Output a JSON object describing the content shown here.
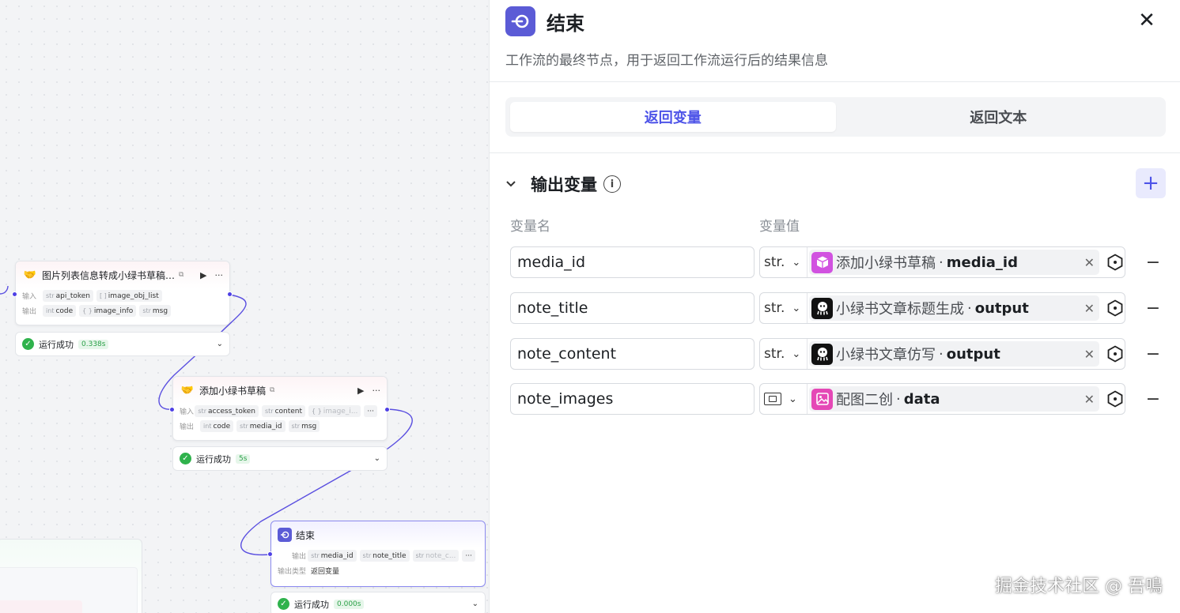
{
  "canvas": {
    "node1": {
      "title": "图片列表信息转成小绿书草稿…",
      "input_label": "输入",
      "output_label": "输出",
      "inputs": [
        {
          "type": "str",
          "name": "api_token"
        },
        {
          "type": "[ ]",
          "name": "image_obj_list"
        }
      ],
      "outputs": [
        {
          "type": "int",
          "name": "code"
        },
        {
          "type": "{ }",
          "name": "image_info"
        },
        {
          "type": "str",
          "name": "msg"
        }
      ],
      "status": "运行成功",
      "time": "0.338s"
    },
    "node2": {
      "title": "添加小绿书草稿",
      "input_label": "输入",
      "output_label": "输出",
      "inputs": [
        {
          "type": "str",
          "name": "access_token"
        },
        {
          "type": "str",
          "name": "content"
        },
        {
          "type": "{ }",
          "name": "image_i..."
        }
      ],
      "outputs": [
        {
          "type": "int",
          "name": "code"
        },
        {
          "type": "str",
          "name": "media_id"
        },
        {
          "type": "str",
          "name": "msg"
        }
      ],
      "status": "运行成功",
      "time": "5s"
    },
    "node3": {
      "title": "结束",
      "output_label": "输出",
      "outputs": [
        {
          "type": "str",
          "name": "media_id"
        },
        {
          "type": "str",
          "name": "note_title"
        },
        {
          "type": "str",
          "name": "note_c..."
        }
      ],
      "output_type_label": "输出类型",
      "output_type_value": "返回变量",
      "status": "运行成功",
      "time": "0.000s"
    }
  },
  "panel": {
    "title": "结束",
    "description": "工作流的最终节点，用于返回工作流运行后的结果信息",
    "tabs": [
      {
        "label": "返回变量",
        "active": true
      },
      {
        "label": "返回文本",
        "active": false
      }
    ],
    "section_title": "输出变量",
    "col_name": "变量名",
    "col_value": "变量值",
    "rows": [
      {
        "name": "media_id",
        "type": "str.",
        "ref_icon": "cube-icon",
        "ref_node": "添加小绿书草稿",
        "ref_field": "media_id"
      },
      {
        "name": "note_title",
        "type": "str.",
        "ref_icon": "llm-icon",
        "ref_node": "小绿书文章标题生成",
        "ref_field": "output"
      },
      {
        "name": "note_content",
        "type": "str.",
        "ref_icon": "llm-icon",
        "ref_node": "小绿书文章仿写",
        "ref_field": "output"
      },
      {
        "name": "note_images",
        "type": "image",
        "ref_icon": "image-gen-icon",
        "ref_node": "配图二创",
        "ref_field": "data"
      }
    ],
    "separator": "·"
  },
  "watermark": "掘金技术社区 @ 吾鳴",
  "colors": {
    "accent": "#4d53e8",
    "end_icon": "#5b5bd6",
    "success": "#2fb24c"
  }
}
